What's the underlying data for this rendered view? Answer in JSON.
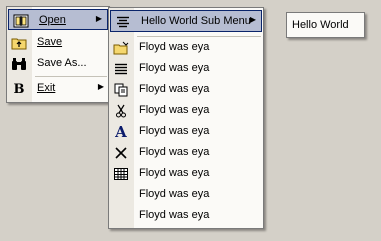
{
  "main_menu": {
    "items": [
      {
        "label": "Open",
        "icon": "folder-book-icon",
        "has_submenu": true,
        "highlighted": true
      },
      {
        "label": "Save",
        "icon": "folder-up-icon",
        "has_submenu": false
      },
      {
        "label": "Save As...",
        "icon": "binoculars-icon",
        "has_submenu": false
      },
      {
        "label": "Exit",
        "icon": "bold-b-icon",
        "has_submenu": true
      }
    ]
  },
  "submenu_1": {
    "header": {
      "label": "Hello World Sub Menu",
      "icon": "align-lines-icon",
      "has_submenu": true,
      "highlighted": true
    },
    "items": [
      {
        "label": "Floyd was eya",
        "icon": "open-folder-icon"
      },
      {
        "label": "Floyd was eya",
        "icon": "list-lines-icon"
      },
      {
        "label": "Floyd was eya",
        "icon": "copy-icon"
      },
      {
        "label": "Floyd was eya",
        "icon": "scissors-icon"
      },
      {
        "label": "Floyd was eya",
        "icon": "font-a-icon"
      },
      {
        "label": "Floyd was eya",
        "icon": "delete-x-icon"
      },
      {
        "label": "Floyd was eya",
        "icon": "table-grid-icon"
      },
      {
        "label": "Floyd was eya",
        "icon": ""
      },
      {
        "label": "Floyd was eya",
        "icon": ""
      }
    ]
  },
  "submenu_2": {
    "items": [
      {
        "label": "Hello World"
      }
    ]
  },
  "colors": {
    "background": "#d4d0c8",
    "menu_bg": "#fbfaf7",
    "icon_strip": "#ece9e2",
    "highlight_bg": "#b6bdd2",
    "highlight_border": "#0a246a"
  }
}
